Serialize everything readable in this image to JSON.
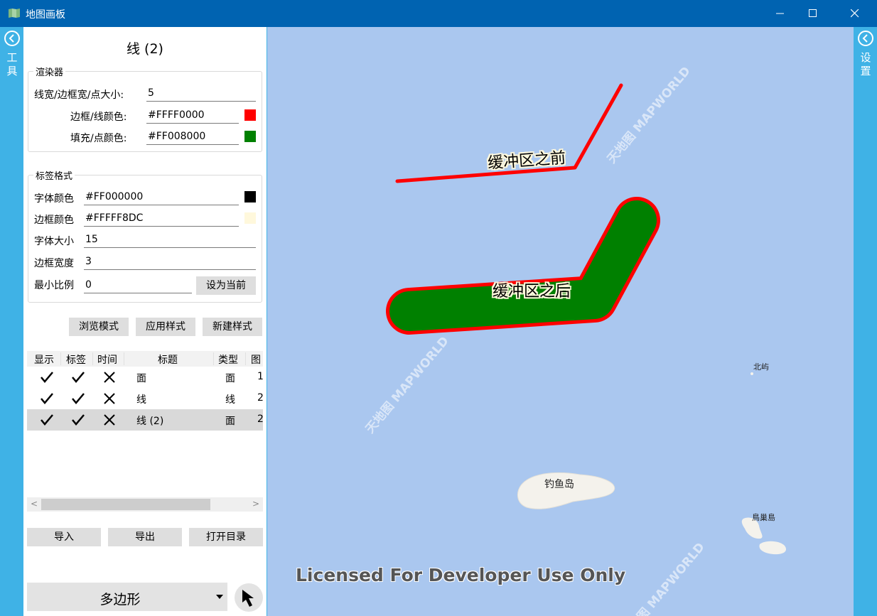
{
  "window": {
    "title": "地图画板",
    "icon": "map-icon"
  },
  "left_rail": {
    "label": "工具",
    "chars": [
      "工",
      "具"
    ],
    "icon": "chevron-left-circle-icon"
  },
  "right_rail": {
    "label": "设置",
    "chars": [
      "设",
      "置"
    ],
    "icon": "chevron-left-circle-icon"
  },
  "panel": {
    "title": "线 (2)",
    "renderer": {
      "legend": "渲染器",
      "width_label": "线宽/边框宽/点大小:",
      "width_value": "5",
      "border_color_label": "边框/线颜色:",
      "border_color_value": "#FFFF0000",
      "border_swatch": "#ff0000",
      "fill_color_label": "填充/点颜色:",
      "fill_color_value": "#FF008000",
      "fill_swatch": "#008000"
    },
    "label_format": {
      "legend": "标签格式",
      "font_color_label": "字体颜色",
      "font_color_value": "#FF000000",
      "font_swatch": "#000000",
      "border_color_label": "边框颜色",
      "border_color_value": "#FFFFF8DC",
      "border_swatch": "#fff8dc",
      "font_size_label": "字体大小",
      "font_size_value": "15",
      "border_width_label": "边框宽度",
      "border_width_value": "3",
      "min_scale_label": "最小比例",
      "min_scale_value": "0",
      "set_current_button": "设为当前"
    },
    "buttons": {
      "browse": "浏览模式",
      "apply": "应用样式",
      "new_style": "新建样式"
    },
    "layers": {
      "columns": [
        "显示",
        "标签",
        "时间",
        "标题",
        "类型",
        "图"
      ],
      "rows": [
        {
          "show": true,
          "label": true,
          "time": false,
          "title": "面",
          "type": "面",
          "count": "1",
          "selected": false
        },
        {
          "show": true,
          "label": true,
          "time": false,
          "title": "线",
          "type": "线",
          "count": "2",
          "selected": false
        },
        {
          "show": true,
          "label": true,
          "time": false,
          "title": "线 (2)",
          "type": "面",
          "count": "2",
          "selected": true
        }
      ]
    },
    "io_buttons": {
      "import": "导入",
      "export": "导出",
      "open_dir": "打开目录"
    },
    "draw_mode": {
      "selected": "多边形"
    }
  },
  "map": {
    "before_label": "缓冲区之前",
    "after_label": "缓冲区之后",
    "islands": {
      "diaoyu": "钓鱼岛",
      "beiyu": "北屿",
      "niaochao": "鳥巢島"
    },
    "license": "Licensed For Developer Use Only",
    "watermark": "天地图 MAPWORLD",
    "colors": {
      "water": "#aac7ef",
      "line": "#ff0000",
      "buffer_fill": "#008000",
      "buffer_border": "#ff0000",
      "label_halo": "#fff8dc"
    }
  }
}
